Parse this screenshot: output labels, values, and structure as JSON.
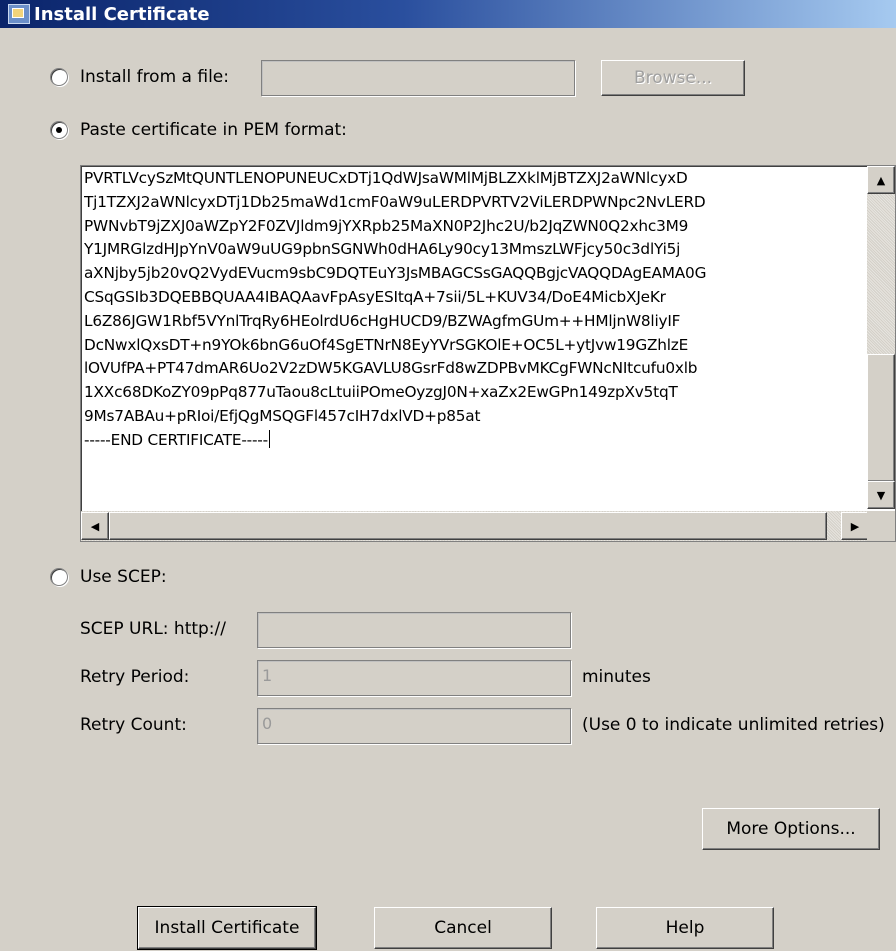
{
  "window": {
    "title": "Install Certificate"
  },
  "install_from_file": {
    "label": "Install from a file:",
    "value": "",
    "browse_label": "Browse..."
  },
  "paste_pem": {
    "label": "Paste certificate in PEM format:",
    "lines": [
      "PVRTLVcySzMtQUNTLENOPUNEUCxDTj1QdWJsaWMlMjBLZXklMjBTZXJ2aWNlcyxD",
      "Tj1TZXJ2aWNlcyxDTj1Db25maWd1cmF0aW9uLERDPVRTV2ViLERDPWNpc2NvLERD",
      "PWNvbT9jZXJ0aWZpY2F0ZVJldm9jYXRpb25MaXN0P2Jhc2U/b2JqZWN0Q2xhc3M9",
      "Y1JMRGlzdHJpYnV0aW9uUG9pbnSGNWh0dHA6Ly90cy13MmszLWFjcy50c3dlYi5j",
      "aXNjby5jb20vQ2VydEVucm9sbC9DQTEuY3JsMBAGCSsGAQQBgjcVAQQDAgEAMA0G",
      "CSqGSIb3DQEBBQUAA4IBAQAavFpAsyESItqA+7sii/5L+KUV34/DoE4MicbXJeKr",
      "L6Z86JGW1Rbf5VYnlTrqRy6HEolrdU6cHgHUCD9/BZWAgfmGUm++HMljnW8liyIF",
      "DcNwxlQxsDT+n9YOk6bnG6uOf4SgETNrN8EyYVrSGKOlE+OC5L+ytJvw19GZhlzE",
      "lOVUfPA+PT47dmAR6Uo2V2zDW5KGAVLU8GsrFd8wZDPBvMKCgFWNcNItcufu0xlb",
      "1XXc68DKoZY09pPq877uTaou8cLtuiiPOmeOyzgJ0N+xaZx2EwGPn149zpXv5tqT",
      "9Ms7ABAu+pRIoi/EfjQgMSQGFl457cIH7dxlVD+p85at",
      "-----END CERTIFICATE-----"
    ]
  },
  "scep": {
    "label": "Use SCEP:",
    "url_label": "SCEP URL: http://",
    "url_value": "",
    "retry_period_label": "Retry Period:",
    "retry_period_value": "1",
    "retry_period_unit": "minutes",
    "retry_count_label": "Retry Count:",
    "retry_count_value": "0",
    "retry_count_hint": "(Use 0 to indicate unlimited retries)"
  },
  "buttons": {
    "more_options": "More Options...",
    "install": "Install Certificate",
    "cancel": "Cancel",
    "help": "Help"
  },
  "icons": {
    "app": "certificate-window-icon",
    "scroll_up": "▲",
    "scroll_down": "▼",
    "scroll_left": "◀",
    "scroll_right": "▶"
  },
  "colors": {
    "dialog_bg": "#d4d0c8",
    "title_start": "#0a246a",
    "title_end": "#a6caf0"
  }
}
